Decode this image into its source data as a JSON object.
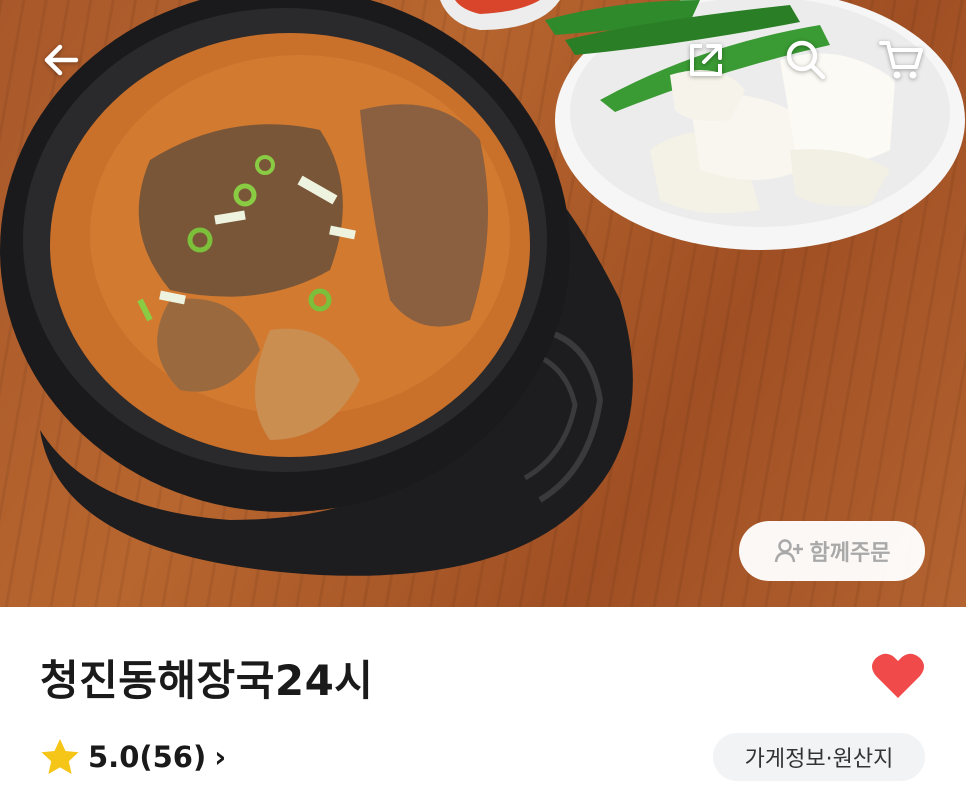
{
  "hero": {
    "image_description_icon": "food-photo",
    "together_order_label": "함께주문",
    "together_icon": "person-add-icon"
  },
  "header": {
    "back_icon": "back-arrow-icon",
    "share_icon": "share-icon",
    "search_icon": "search-icon",
    "cart_icon": "cart-icon"
  },
  "store": {
    "name": "청진동해장국24시",
    "rating": "5.0",
    "review_count": "(56)",
    "rating_chevron": "›",
    "info_button_label": "가게정보·원산지",
    "favorited": true
  },
  "colors": {
    "heart": "#f04a4a",
    "star": "#f5c518",
    "button_bg": "#f1f3f5"
  }
}
